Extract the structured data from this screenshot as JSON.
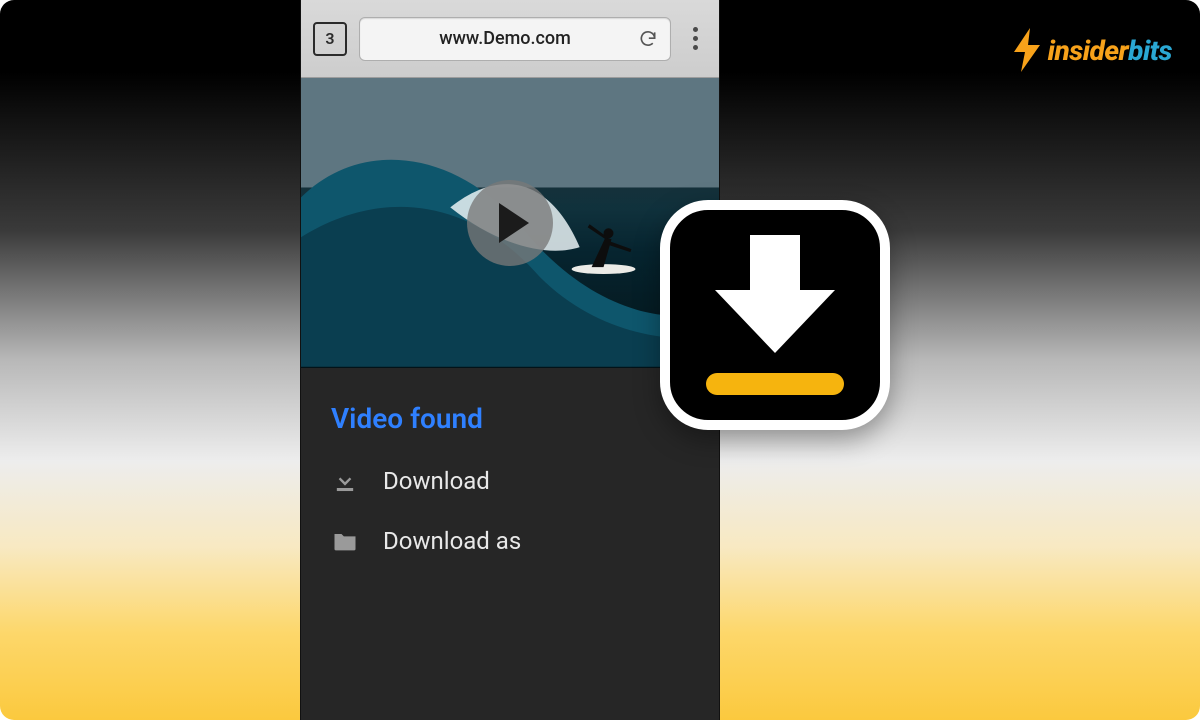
{
  "logo": {
    "word_part1": "insider",
    "word_part2": "bits"
  },
  "browser": {
    "tab_count": "3",
    "url": "www.Demo.com"
  },
  "sheet": {
    "title": "Video found",
    "download_label": "Download",
    "download_as_label": "Download as"
  },
  "colors": {
    "link_blue": "#2f80ff",
    "accent_yellow": "#f6b40e",
    "logo_orange": "#f8a21a",
    "logo_blue": "#2aa8d4"
  }
}
